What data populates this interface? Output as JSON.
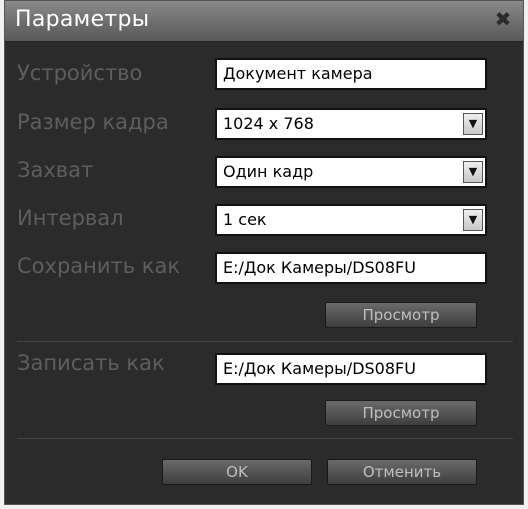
{
  "dialog": {
    "title": "Параметры",
    "close_glyph": "✖"
  },
  "fields": {
    "device": {
      "label": "Устройство",
      "value": "Документ камера"
    },
    "frame_size": {
      "label": "Размер кадра",
      "value": "1024 x 768"
    },
    "capture": {
      "label": "Захват",
      "value": "Один кадр"
    },
    "interval": {
      "label": "Интервал",
      "value": "1 сек"
    },
    "save_as": {
      "label": "Сохранить как",
      "value": "E:/Док Камеры/DS08FU"
    },
    "record_as": {
      "label": "Записать как",
      "value": "E:/Док Камеры/DS08FU"
    }
  },
  "buttons": {
    "browse_save": "Просмотр",
    "browse_record": "Просмотр",
    "ok": "OK",
    "cancel": "Отменить"
  },
  "icons": {
    "dropdown": "chevron-down-icon",
    "dropdown_glyph": "▼"
  }
}
